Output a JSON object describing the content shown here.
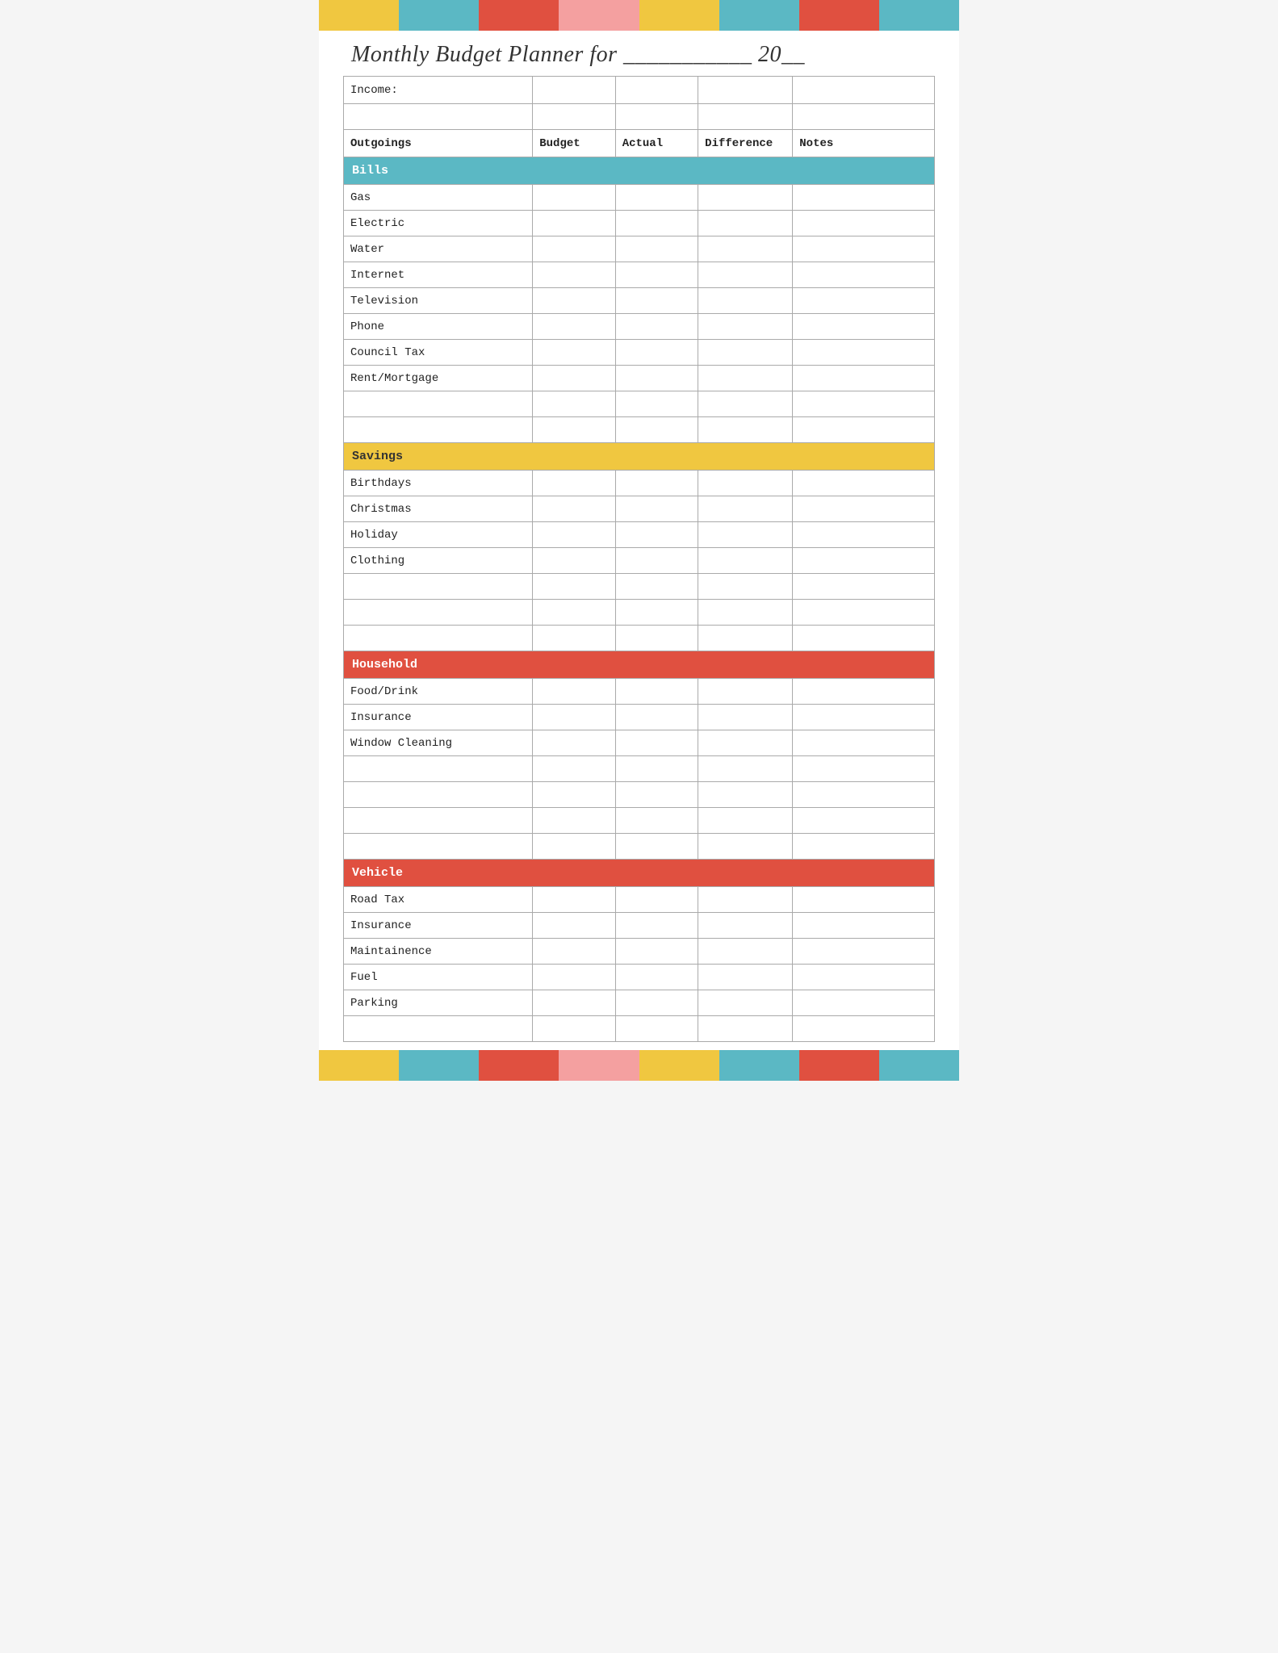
{
  "colorBars": {
    "top": [
      "#f0c740",
      "#5bb8c4",
      "#e05040",
      "#f4a0a0",
      "#f0c740",
      "#5bb8c4",
      "#e05040",
      "#5bb8c4"
    ],
    "bottom": [
      "#f0c740",
      "#5bb8c4",
      "#e05040",
      "#f4a0a0",
      "#f0c740",
      "#5bb8c4",
      "#e05040",
      "#5bb8c4"
    ]
  },
  "title": "Monthly Budget Planner for ___________ 20__",
  "incomeLabel": "Income:",
  "columns": {
    "outgoings": "Outgoings",
    "budget": "Budget",
    "actual": "Actual",
    "difference": "Difference",
    "notes": "Notes"
  },
  "sections": [
    {
      "name": "bills",
      "label": "Bills",
      "color": "#5bb8c4",
      "textColor": "white",
      "rows": [
        "Gas",
        "Electric",
        "Water",
        "Internet",
        "Television",
        "Phone",
        "Council Tax",
        "Rent/Mortgage",
        "",
        ""
      ]
    },
    {
      "name": "savings",
      "label": "Savings",
      "color": "#f0c740",
      "textColor": "#333",
      "rows": [
        "Birthdays",
        "Christmas",
        "Holiday",
        "Clothing",
        "",
        "",
        ""
      ]
    },
    {
      "name": "household",
      "label": "Household",
      "color": "#e05040",
      "textColor": "white",
      "rows": [
        "Food/Drink",
        "Insurance",
        "Window Cleaning",
        "",
        "",
        "",
        ""
      ]
    },
    {
      "name": "vehicle",
      "label": "Vehicle",
      "color": "#e05040",
      "textColor": "white",
      "rows": [
        "Road Tax",
        "Insurance",
        "Maintainence",
        "Fuel",
        "Parking",
        ""
      ]
    }
  ]
}
